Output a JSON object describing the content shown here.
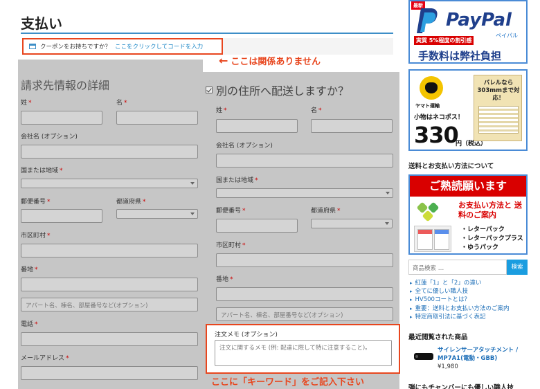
{
  "page": {
    "title": "支払い"
  },
  "coupon": {
    "prompt": "クーポンをお持ちですか？",
    "link": "ここをクリックしてコードを入力"
  },
  "annotations": {
    "not_related": "ここは関係ありません",
    "keyword_here": "ここに「キーワード」をご記入下さい",
    "arrow": "←"
  },
  "billing": {
    "heading": "請求先情報の詳細",
    "last_name": "姓",
    "first_name": "名",
    "company": "会社名 (オプション)",
    "country": "国または地域",
    "postcode": "郵便番号",
    "prefecture": "都道府県",
    "city": "市区町村",
    "address": "番地",
    "address2_placeholder": "アパート名、棟名、部屋番号など(オプション)",
    "phone": "電話",
    "email": "メールアドレス"
  },
  "shipping": {
    "heading": "別の住所へ配送しますか？",
    "last_name": "姓",
    "first_name": "名",
    "company": "会社名 (オプション)",
    "country": "国または地域",
    "postcode": "郵便番号",
    "prefecture": "都道府県",
    "city": "市区町村",
    "address": "番地",
    "address2_placeholder": "アパート名、棟名、部屋番号など(オプション)"
  },
  "required_mark": "*",
  "order_notes": {
    "label": "注文メモ (オプション)",
    "placeholder": "注文に関するメモ (例: 配達に際して特に注意すること)。"
  },
  "sidebar": {
    "paypal": {
      "tag": "最新",
      "brand": "PayPal",
      "kana": "ペイパル",
      "discount": "実質 5%程度の割引感",
      "fee": "手数料は弊社負担"
    },
    "yamato": {
      "pack": "バレルなら 303mmまで対応！",
      "name": "ヤマト運輸",
      "small": "小物はネコポス！",
      "price": "330",
      "unit": "円（税込）"
    },
    "shipping_heading": "送料とお支払い方法について",
    "notice": {
      "title": "ご熟読願います",
      "subtitle": "お支払い方法と 送料のご案内",
      "items": [
        "・レターパック",
        "・レターパックプラス",
        "・ゆうパック"
      ]
    },
    "search": {
      "placeholder": "商品検索 …",
      "button": "検索"
    },
    "links": [
      "紅蓮「1」と「2」の違い",
      "全てに優しい職人技",
      "HV500コートとは？",
      "重要：送料とお支払い方法のご案内",
      "特定商取引法に基づく表記"
    ],
    "recent_heading": "最近閲覧された商品",
    "recent": {
      "title": "サイレンサーアタッチメント / MP7A1(電動・GBB)",
      "price": "¥1,980"
    },
    "cut_text": "弾にもチャンバーにも優しい職人技"
  }
}
